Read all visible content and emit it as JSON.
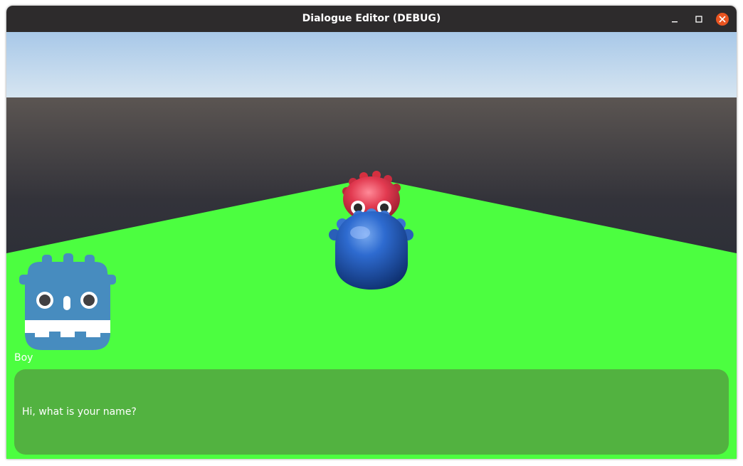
{
  "window": {
    "title": "Dialogue Editor (DEBUG)"
  },
  "icons": {
    "minimize": "minimize-icon",
    "maximize": "maximize-icon",
    "close": "close-icon",
    "portrait": "godot-robot-icon"
  },
  "dialogue": {
    "speaker": "Boy",
    "text": "Hi, what is your name?"
  },
  "colors": {
    "titlebar": "#2d2b2c",
    "close_button": "#e95420",
    "ground": "#4cfe40",
    "dialog_box": "#52b240",
    "portrait": "#478cbf",
    "character_blue": "#2c67c2",
    "character_red": "#e0334a"
  }
}
